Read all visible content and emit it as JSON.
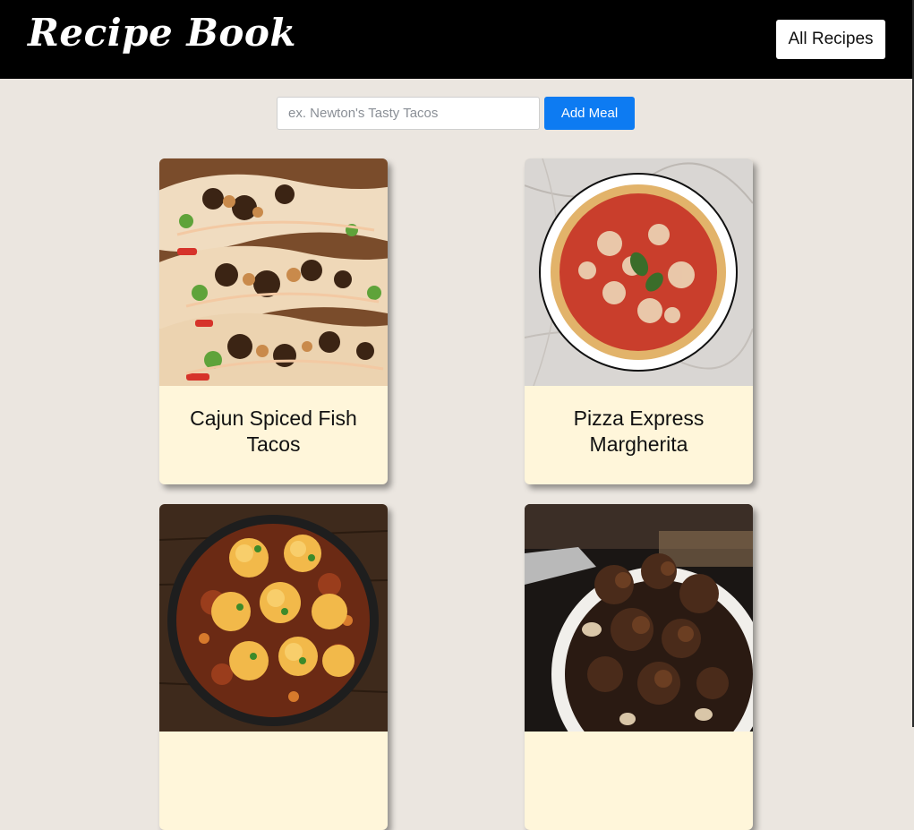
{
  "app": {
    "brand": "Recipe Book",
    "nav_button": "All Recipes"
  },
  "add_meal": {
    "placeholder": "ex. Newton's Tasty Tacos",
    "button_label": "Add Meal"
  },
  "colors": {
    "header_bg": "#000000",
    "page_bg": "#ebe6e0",
    "card_bg": "#fff6da",
    "accent": "#0d7bf2"
  },
  "recipes": [
    {
      "title": "Cajun Spiced Fish Tacos",
      "image": "fish-tacos-photo"
    },
    {
      "title": "Pizza Express Margherita",
      "image": "margherita-pizza-photo"
    },
    {
      "title": "",
      "image": "stew-with-dumplings-photo"
    },
    {
      "title": "",
      "image": "beef-stew-bowl-photo"
    }
  ]
}
